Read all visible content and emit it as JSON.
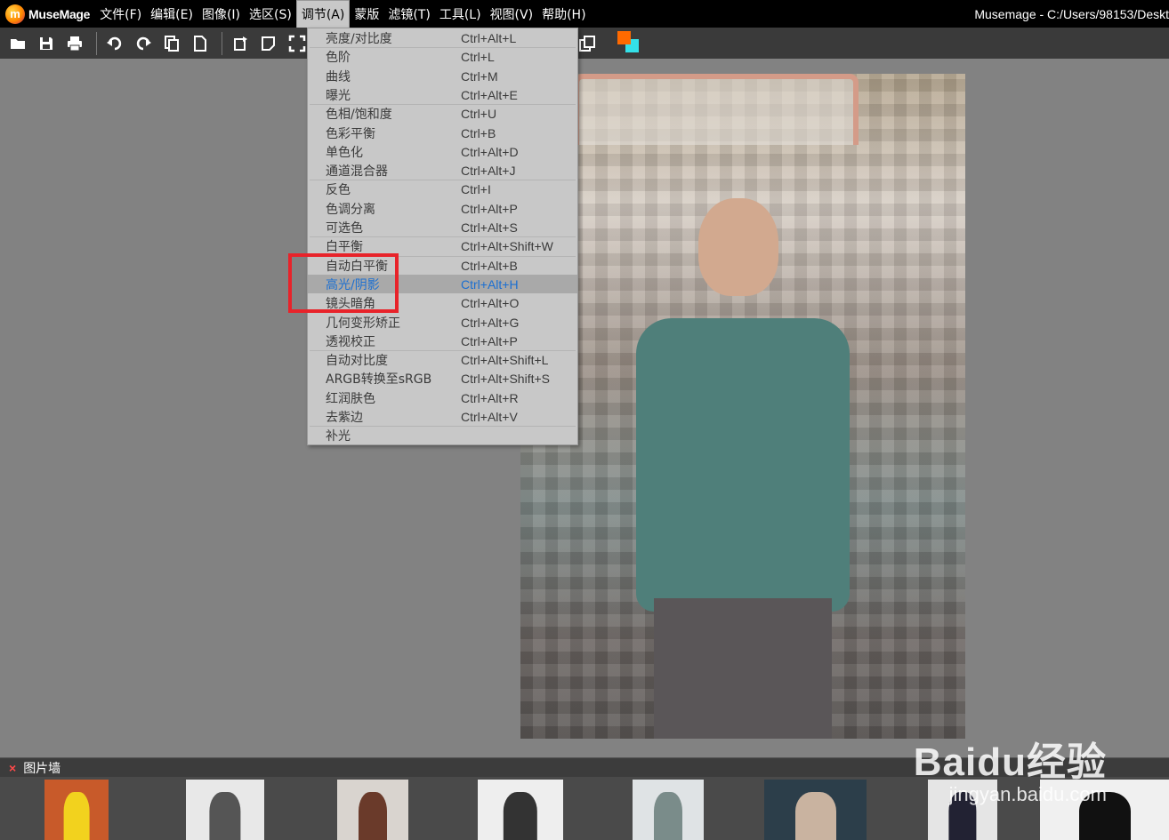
{
  "app": {
    "logo_letter": "m",
    "logo_text": "MuseMage",
    "window_title": "Musemage - C:/Users/98153/Deskt"
  },
  "menubar": [
    {
      "label": "文件(F)"
    },
    {
      "label": "编辑(E)"
    },
    {
      "label": "图像(I)"
    },
    {
      "label": "选区(S)"
    },
    {
      "label": "调节(A)",
      "active": true
    },
    {
      "label": "蒙版"
    },
    {
      "label": "滤镜(T)"
    },
    {
      "label": "工具(L)"
    },
    {
      "label": "视图(V)"
    },
    {
      "label": "帮助(H)"
    }
  ],
  "toolbar": {
    "icons": [
      "open-folder-icon",
      "save-icon",
      "print-icon",
      "undo-icon",
      "redo-icon",
      "copy-icon",
      "new-document-icon",
      "rotate-icon",
      "crop-icon",
      "fit-icon",
      "duplicate-icon"
    ],
    "foreground_color": "#ff6a00",
    "background_color": "#34e0e8"
  },
  "adjust_menu": {
    "items": [
      {
        "label": "亮度/对比度",
        "shortcut": "Ctrl+Alt+L"
      },
      {
        "label": "色阶",
        "shortcut": "Ctrl+L"
      },
      {
        "label": "曲线",
        "shortcut": "Ctrl+M"
      },
      {
        "label": "曝光",
        "shortcut": "Ctrl+Alt+E"
      },
      {
        "label": "色相/饱和度",
        "shortcut": "Ctrl+U"
      },
      {
        "label": "色彩平衡",
        "shortcut": "Ctrl+B"
      },
      {
        "label": "单色化",
        "shortcut": "Ctrl+Alt+D"
      },
      {
        "label": "通道混合器",
        "shortcut": "Ctrl+Alt+J"
      },
      {
        "label": "反色",
        "shortcut": "Ctrl+I"
      },
      {
        "label": "色调分离",
        "shortcut": "Ctrl+Alt+P"
      },
      {
        "label": "可选色",
        "shortcut": "Ctrl+Alt+S"
      },
      {
        "label": "白平衡",
        "shortcut": "Ctrl+Alt+Shift+W"
      },
      {
        "label": "自动白平衡",
        "shortcut": "Ctrl+Alt+B"
      },
      {
        "label": "高光/阴影",
        "shortcut": "Ctrl+Alt+H",
        "highlighted": true
      },
      {
        "label": "镜头暗角",
        "shortcut": "Ctrl+Alt+O"
      },
      {
        "label": "几何变形矫正",
        "shortcut": "Ctrl+Alt+G"
      },
      {
        "label": "透视校正",
        "shortcut": "Ctrl+Alt+P"
      },
      {
        "label": "自动对比度",
        "shortcut": "Ctrl+Alt+Shift+L"
      },
      {
        "label": "ARGB转换至sRGB",
        "shortcut": "Ctrl+Alt+Shift+S"
      },
      {
        "label": "红润肤色",
        "shortcut": "Ctrl+Alt+R"
      },
      {
        "label": "去紫边",
        "shortcut": "Ctrl+Alt+V"
      },
      {
        "label": "补光",
        "shortcut": ""
      }
    ],
    "highlight_color": "#1b6fd1",
    "annotation_color": "#e8232a"
  },
  "picture_wall": {
    "close_label": "×",
    "title": "图片墙",
    "thumbnails": [
      "thumb-1",
      "thumb-2",
      "thumb-3",
      "thumb-4",
      "thumb-5",
      "thumb-6",
      "thumb-7",
      "thumb-8"
    ]
  },
  "watermark": {
    "brand": "Baidu经验",
    "url": "jingyan.baidu.com"
  }
}
